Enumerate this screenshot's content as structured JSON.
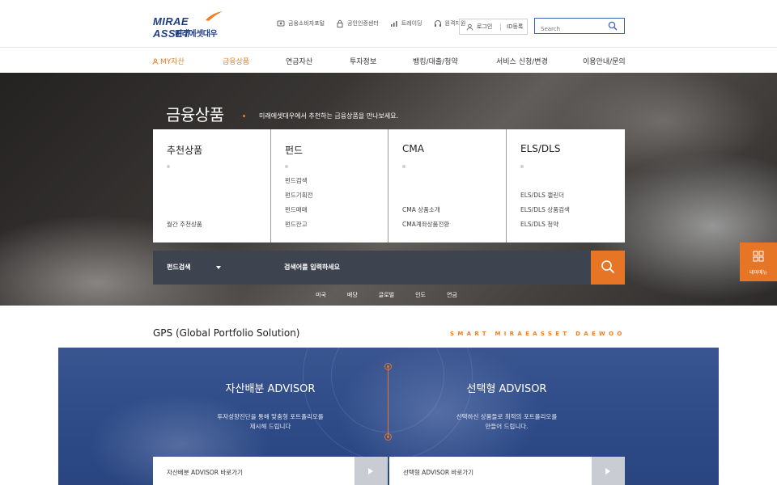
{
  "brand": {
    "logo_main": "MIRAE ASSET",
    "logo_sub": "미래에셋대우",
    "accent": "#f07e23",
    "navy": "#1f3f86"
  },
  "utility": {
    "items": [
      {
        "label": "금융소비자포털",
        "icon": "consumer-portal-icon"
      },
      {
        "label": "공인인증센터",
        "icon": "lock-icon"
      },
      {
        "label": "트레이딩",
        "icon": "chart-icon"
      },
      {
        "label": "원격지원",
        "icon": "headset-icon"
      }
    ],
    "login_label": "로그인",
    "register_label": "ID등록",
    "search_placeholder": "Search"
  },
  "gnb": {
    "items": [
      {
        "label": "MY자산",
        "active": false
      },
      {
        "label": "금융상품",
        "active": true
      },
      {
        "label": "연금자산",
        "active": false
      },
      {
        "label": "투자정보",
        "active": false
      },
      {
        "label": "뱅킹/대출/청약",
        "active": false
      },
      {
        "label": "서비스 신청/변경",
        "active": false
      },
      {
        "label": "이용안내/문의",
        "active": false
      }
    ]
  },
  "hero": {
    "title": "금융상품",
    "subtitle": "미래에셋대우에서 추천하는 금융상품을 만나보세요.",
    "cards": [
      {
        "title": "추천상품",
        "links": [
          "월간 추천상품"
        ]
      },
      {
        "title": "펀드",
        "links": [
          "펀드검색",
          "펀드기획전",
          "펀드매매",
          "펀드잔고"
        ]
      },
      {
        "title": "CMA",
        "links": [
          "CMA 상품소개",
          "CMA계좌상품전환"
        ]
      },
      {
        "title": "ELS/DLS",
        "links": [
          "ELS/DLS 캘린더",
          "ELS/DLS 상품검색",
          "ELS/DLS 청약"
        ]
      }
    ],
    "search": {
      "select_value": "펀드검색",
      "placeholder": "검색어를 입력하세요"
    },
    "tags": [
      "미국",
      "배당",
      "글로벌",
      "인도",
      "연금"
    ]
  },
  "quick_menu": {
    "label": "테마메뉴"
  },
  "gps": {
    "title": "GPS (Global Portfolio Solution)",
    "slogan": "SMART MIRAEASSET DAEWOO",
    "advisors": [
      {
        "title": "자산배분 ADVISOR",
        "desc": "투자성향진단을 통해  맞춤형 포트폴리오를\n제시해 드립니다",
        "link": "자산배분 ADVISOR 바로가기"
      },
      {
        "title": "선택형 ADVISOR",
        "desc": "선택하신 상품들로 최적의 포트폴리오를\n만들어 드립니다.",
        "link": "선택형 ADVISOR 바로가기"
      }
    ]
  }
}
